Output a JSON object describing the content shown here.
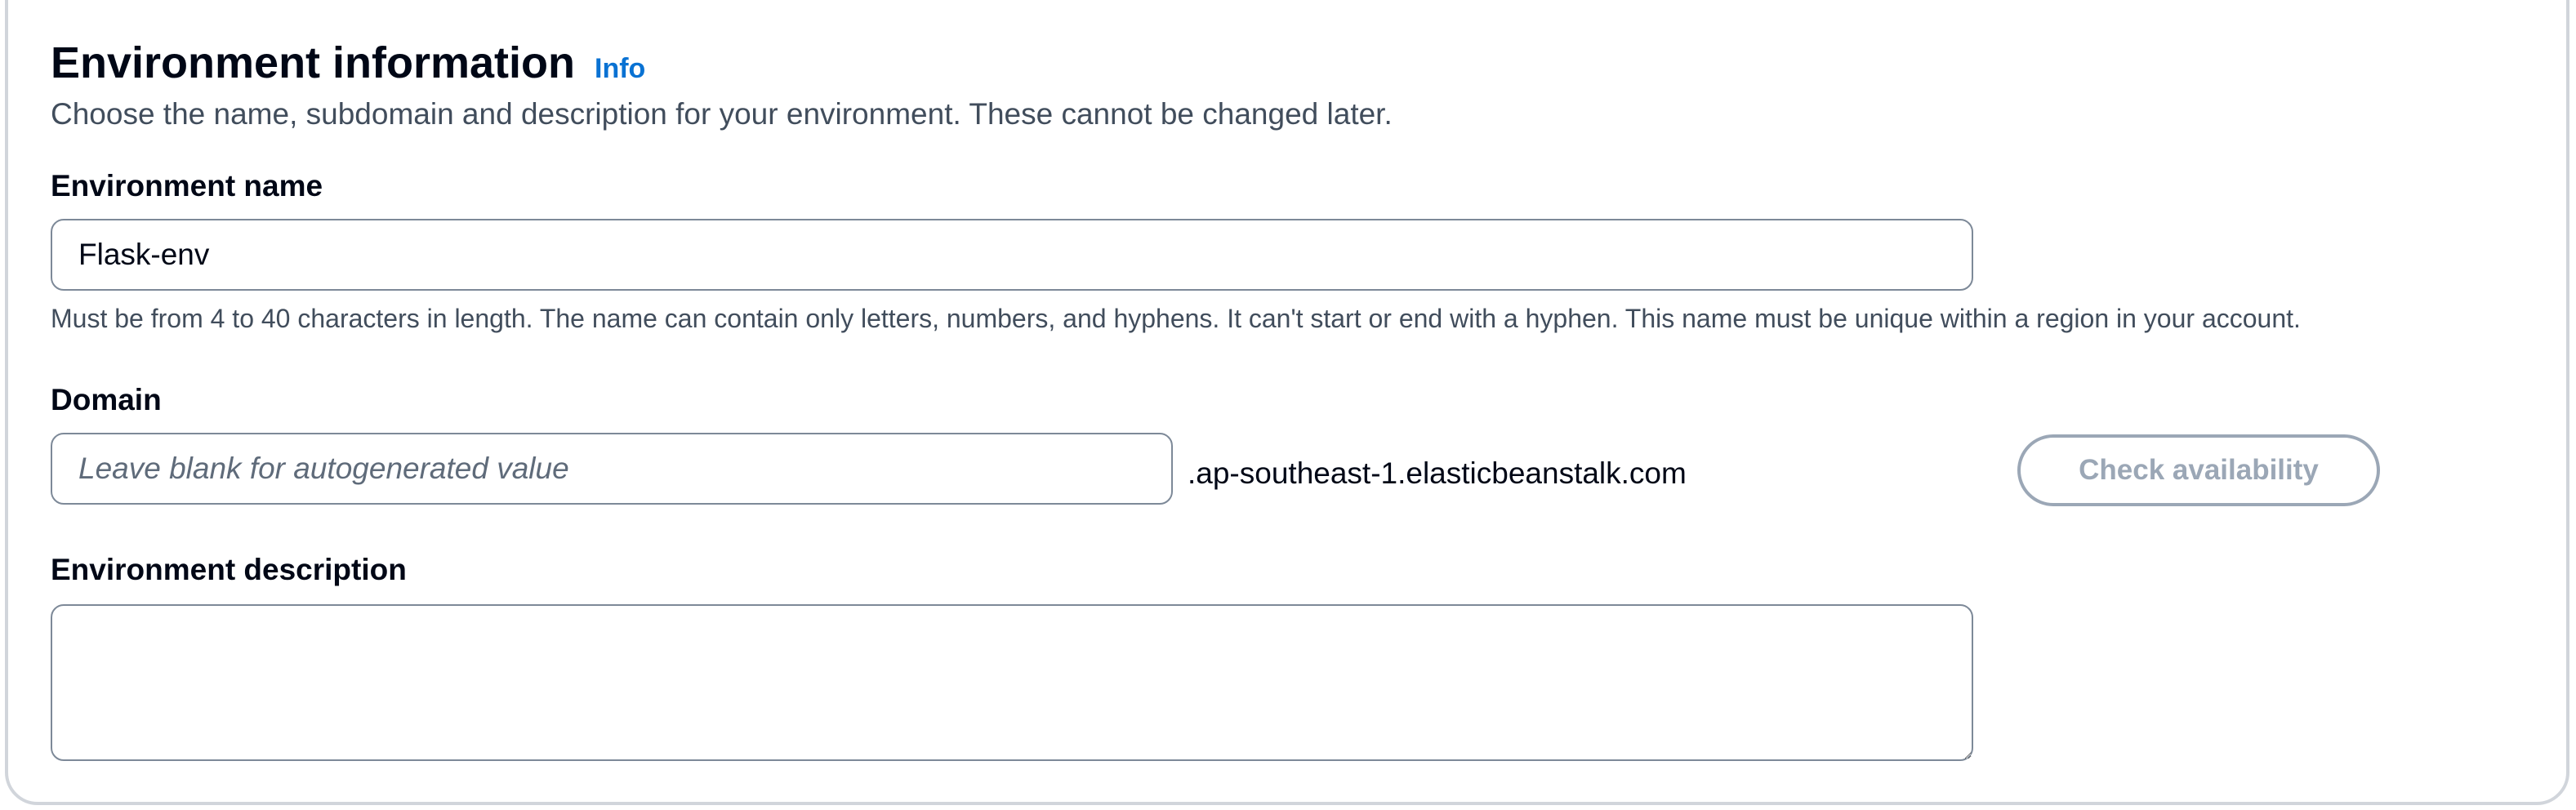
{
  "section": {
    "title": "Environment information",
    "info_label": "Info",
    "description": "Choose the name, subdomain and description for your environment. These cannot be changed later."
  },
  "environment_name": {
    "label": "Environment name",
    "value": "Flask-env",
    "constraint": "Must be from 4 to 40 characters in length. The name can contain only letters, numbers, and hyphens. It can't start or end with a hyphen. This name must be unique within a region in your account."
  },
  "domain": {
    "label": "Domain",
    "placeholder": "Leave blank for autogenerated value",
    "value": "",
    "suffix": ".ap-southeast-1.elasticbeanstalk.com",
    "check_button_label": "Check availability",
    "check_button_enabled": false
  },
  "environment_description": {
    "label": "Environment description",
    "value": ""
  },
  "colors": {
    "link": "#0972d3",
    "text_primary": "#000716",
    "text_secondary": "#414d5c",
    "input_border": "#7d8998",
    "disabled": "#9ba7b6",
    "panel_border": "#d1d5db"
  }
}
